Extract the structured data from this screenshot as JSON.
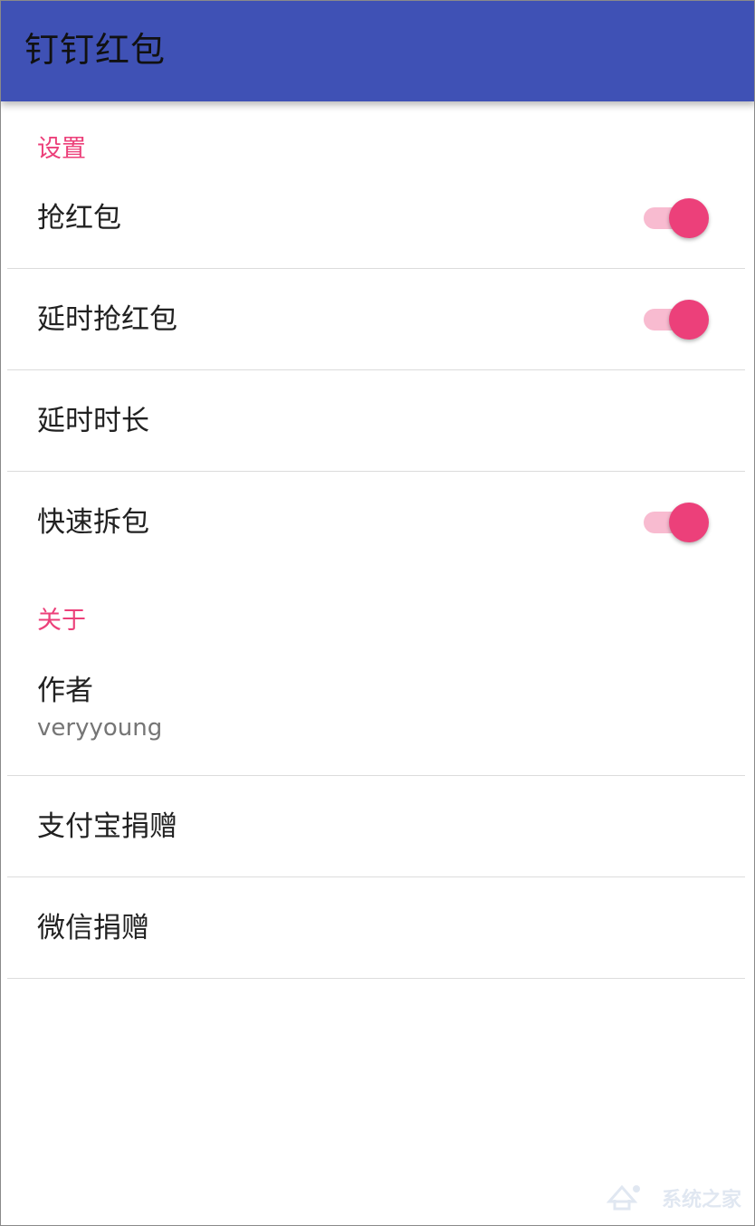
{
  "appbar": {
    "title": "钉钉红包"
  },
  "settings_category": {
    "label": "设置"
  },
  "settings": [
    {
      "title": "抢红包",
      "switch_on": true
    },
    {
      "title": "延时抢红包",
      "switch_on": true
    },
    {
      "title": "延时时长"
    },
    {
      "title": "快速拆包",
      "switch_on": true
    }
  ],
  "about_category": {
    "label": "关于"
  },
  "about": {
    "author": {
      "title": "作者",
      "summary": "veryyoung"
    },
    "alipay": {
      "title": "支付宝捐赠"
    },
    "wechat": {
      "title": "微信捐赠"
    }
  },
  "colors": {
    "appbar": "#3f51b5",
    "accent": "#ec407a",
    "track_on": "#f8bbd0"
  },
  "watermark": {
    "text": "系统之家",
    "icon": "system-home-logo"
  }
}
